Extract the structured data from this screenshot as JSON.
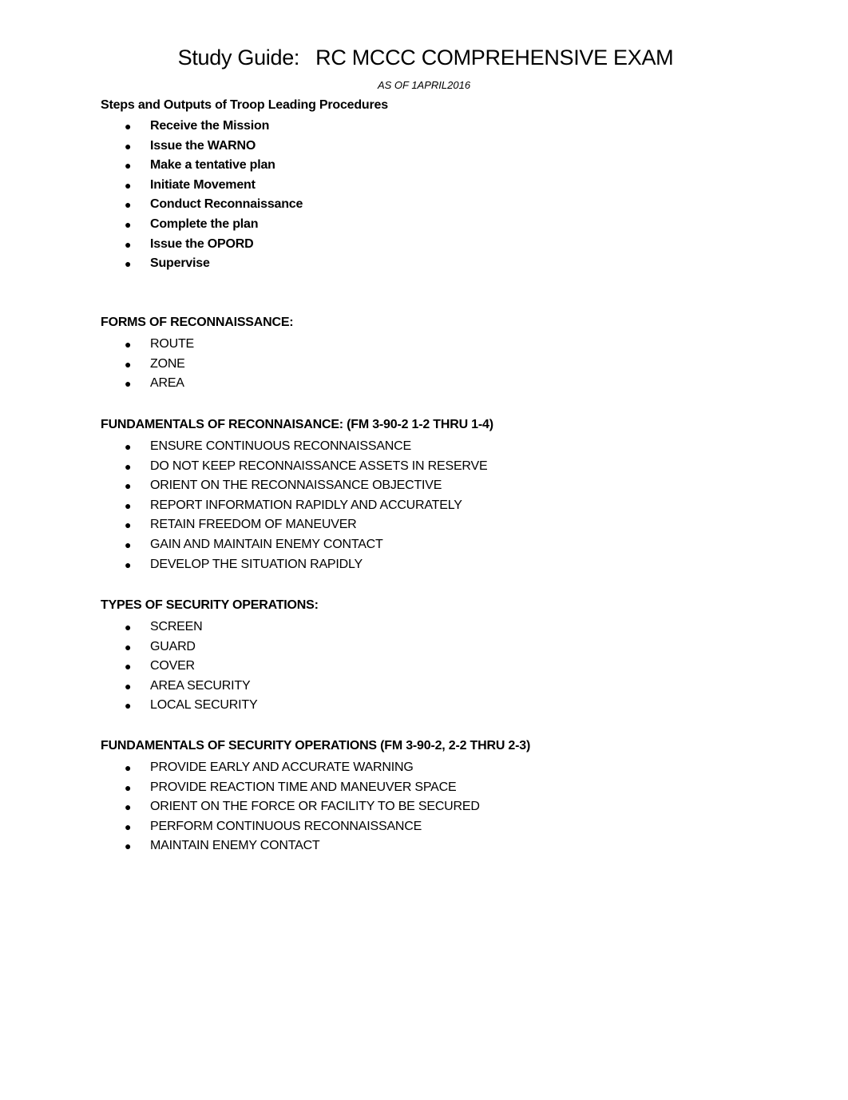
{
  "document": {
    "title_left": "Study Guide:",
    "title_right": "RC MCCC COMPREHENSIVE EXAM",
    "subtitle": "AS OF 1APRIL2016"
  },
  "sections": [
    {
      "heading": "Steps and Outputs of Troop Leading Procedures",
      "items": [
        "Receive the Mission",
        "Issue the WARNO",
        "Make a tentative plan",
        "Initiate Movement",
        "Conduct Reconnaissance",
        "Complete the plan",
        "Issue the OPORD",
        "Supervise"
      ]
    },
    {
      "heading": "FORMS OF RECONNAISSANCE:",
      "items": [
        "ROUTE",
        "ZONE",
        "AREA"
      ]
    },
    {
      "heading": "FUNDAMENTALS OF RECONNAISANCE: (FM 3-90-2 1-2 THRU 1-4)",
      "items": [
        "ENSURE CONTINUOUS RECONNAISSANCE",
        "DO NOT KEEP RECONNAISSANCE ASSETS IN RESERVE",
        "ORIENT ON THE RECONNAISSANCE OBJECTIVE",
        "REPORT INFORMATION RAPIDLY AND ACCURATELY",
        "RETAIN FREEDOM OF MANEUVER",
        "GAIN AND MAINTAIN ENEMY CONTACT",
        "DEVELOP THE SITUATION RAPIDLY"
      ]
    },
    {
      "heading": "TYPES OF SECURITY OPERATIONS:",
      "items": [
        "SCREEN",
        "GUARD",
        "COVER",
        "AREA SECURITY",
        "LOCAL SECURITY"
      ]
    },
    {
      "heading": "FUNDAMENTALS OF SECURITY OPERATIONS (FM 3-90-2, 2-2 THRU 2-3)",
      "items": [
        "PROVIDE EARLY AND ACCURATE WARNING",
        "PROVIDE REACTION TIME AND MANEUVER SPACE",
        "ORIENT ON THE FORCE OR FACILITY TO BE SECURED",
        "PERFORM CONTINUOUS RECONNAISSANCE",
        "MAINTAIN ENEMY CONTACT"
      ]
    }
  ],
  "bullet_glyph": "●"
}
